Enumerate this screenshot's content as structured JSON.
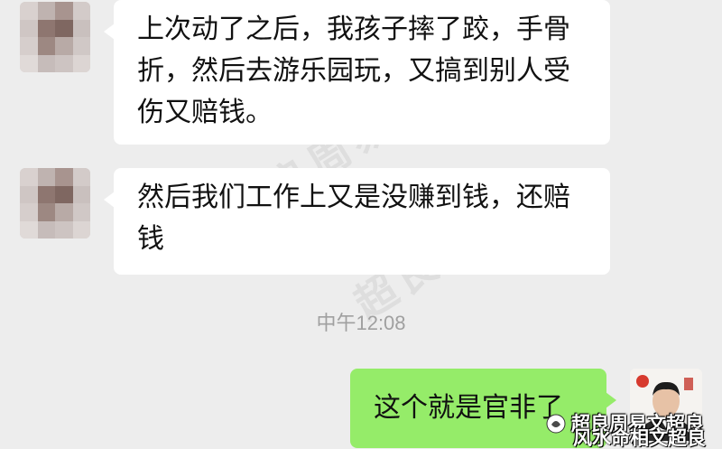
{
  "messages": [
    {
      "sender": "contact",
      "text": "上次动了之后，我孩子摔了跤，手骨折，然后去游乐园玩，又搞到别人受伤又赔钱。"
    },
    {
      "sender": "contact",
      "text": "然后我们工作上又是没赚到钱，还赔钱"
    },
    {
      "sender": "me",
      "text": "这个就是官非了"
    }
  ],
  "timestamp": "中午12:08",
  "watermark": "超良周易",
  "source": {
    "line1": "超良周易文超良",
    "line2": "风水命相文超良"
  },
  "colors": {
    "background": "#ededed",
    "incoming_bubble": "#ffffff",
    "outgoing_bubble": "#95ec69",
    "timestamp": "#a0a0a0"
  },
  "icons": {
    "contact_avatar": "blurred-avatar-icon",
    "my_avatar": "portrait-avatar-icon",
    "source_logo": "wechat-official-account-icon"
  }
}
